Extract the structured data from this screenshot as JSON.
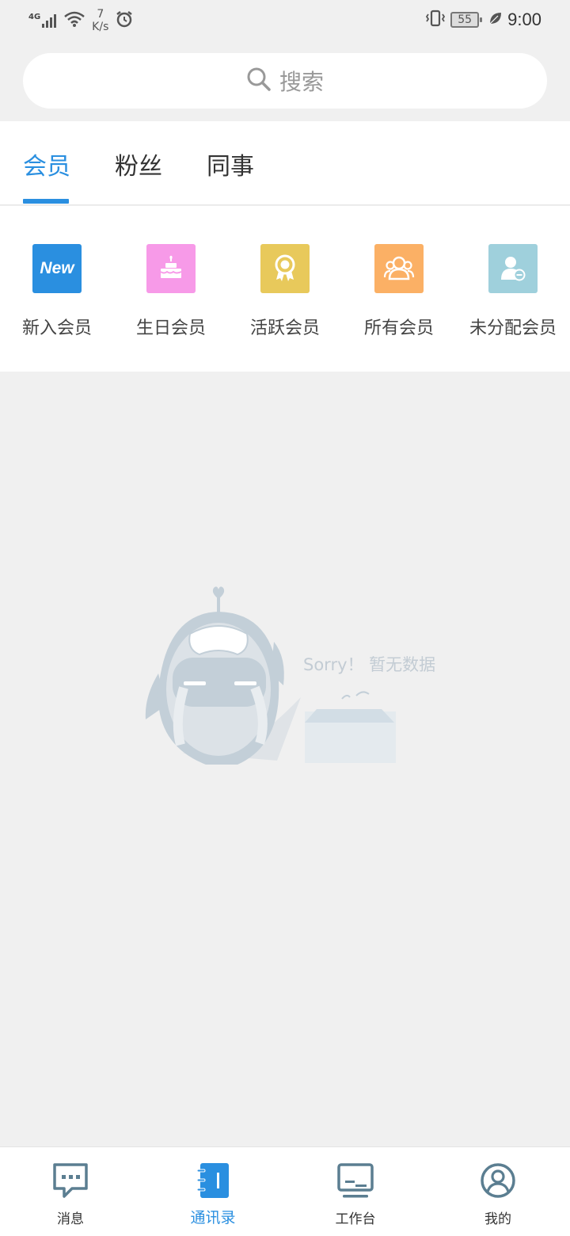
{
  "status_bar": {
    "network_type": "4G",
    "speed_value": "7",
    "speed_unit": "K/s",
    "battery": "55",
    "time": "9:00"
  },
  "search": {
    "placeholder": "搜索"
  },
  "tabs": [
    {
      "label": "会员",
      "active": true
    },
    {
      "label": "粉丝",
      "active": false
    },
    {
      "label": "同事",
      "active": false
    }
  ],
  "categories": [
    {
      "label": "新入会员",
      "icon": "new-badge-icon",
      "color": "#2a8fe0",
      "icon_text": "New"
    },
    {
      "label": "生日会员",
      "icon": "cake-icon",
      "color": "#f79ae8"
    },
    {
      "label": "活跃会员",
      "icon": "award-ribbon-icon",
      "color": "#e8c95b"
    },
    {
      "label": "所有会员",
      "icon": "group-icon",
      "color": "#fbb065"
    },
    {
      "label": "未分配会员",
      "icon": "user-minus-icon",
      "color": "#9fd0dc"
    }
  ],
  "empty_state": {
    "text": "Sorry！ 暂无数据"
  },
  "bottom_nav": [
    {
      "label": "消息",
      "icon": "chat-bubble-icon"
    },
    {
      "label": "通讯录",
      "icon": "contacts-book-icon",
      "active": true
    },
    {
      "label": "工作台",
      "icon": "monitor-icon"
    },
    {
      "label": "我的",
      "icon": "user-circle-icon"
    }
  ],
  "colors": {
    "accent": "#2a8fe0",
    "background": "#f0f0f0",
    "nav_icon": "#5b7e91"
  }
}
